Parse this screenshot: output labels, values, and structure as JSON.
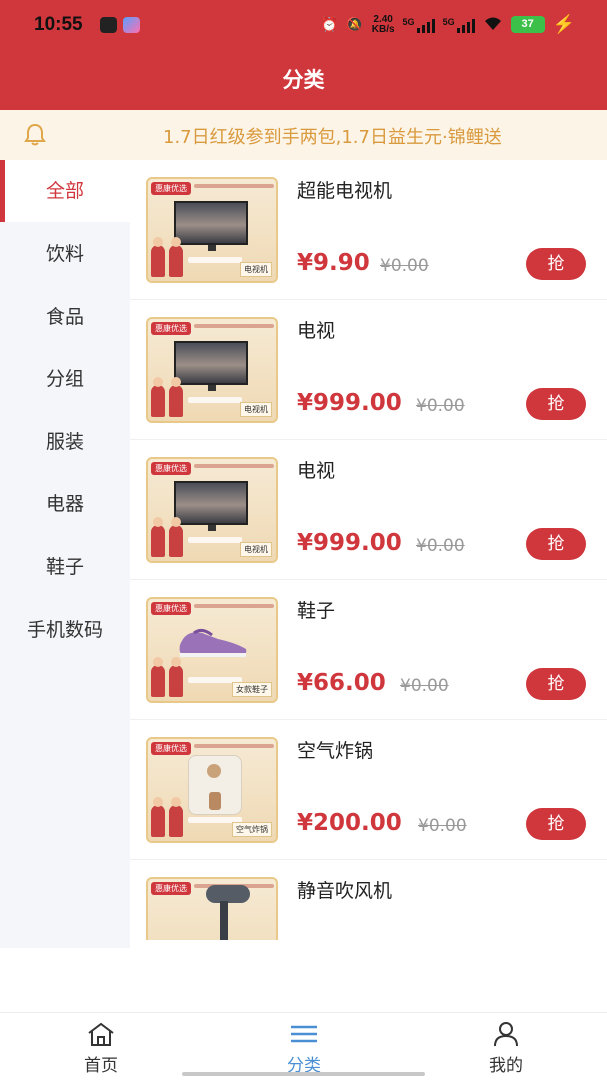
{
  "status_bar": {
    "time": "10:55",
    "speed": "2.40",
    "speed_unit": "KB/s",
    "net1": "5G",
    "net2": "5G",
    "battery": "37"
  },
  "header": {
    "title": "分类"
  },
  "notice": {
    "text": "1.7日红级参到手两包,1.7日益生元·锦鲤送"
  },
  "categories": [
    {
      "label": "全部",
      "active": true
    },
    {
      "label": "饮料"
    },
    {
      "label": "食品"
    },
    {
      "label": "分组"
    },
    {
      "label": "服装"
    },
    {
      "label": "电器"
    },
    {
      "label": "鞋子"
    },
    {
      "label": "手机数码"
    }
  ],
  "products": [
    {
      "name": "超能电视机",
      "price": "¥9.90",
      "original_price": "¥0.00",
      "buy_label": "抢",
      "badge": "惠康优选",
      "thumb_label": "电视机"
    },
    {
      "name": "电视",
      "price": "¥999.00",
      "original_price": "¥0.00",
      "buy_label": "抢",
      "badge": "惠康优选",
      "thumb_label": "电视机"
    },
    {
      "name": "电视",
      "price": "¥999.00",
      "original_price": "¥0.00",
      "buy_label": "抢",
      "badge": "惠康优选",
      "thumb_label": "电视机"
    },
    {
      "name": "鞋子",
      "price": "¥66.00",
      "original_price": "¥0.00",
      "buy_label": "抢",
      "badge": "惠康优选",
      "thumb_label": "女款鞋子"
    },
    {
      "name": "空气炸锅",
      "price": "¥200.00",
      "original_price": "¥0.00",
      "buy_label": "抢",
      "badge": "惠康优选",
      "thumb_label": "空气炸锅"
    },
    {
      "name": "静音吹风机",
      "badge": "惠康优选"
    }
  ],
  "bottom_nav": [
    {
      "label": "首页",
      "icon": "home-icon"
    },
    {
      "label": "分类",
      "icon": "list-icon",
      "active": true
    },
    {
      "label": "我的",
      "icon": "user-icon"
    }
  ],
  "colors": {
    "brand": "#d0373d",
    "notice_text": "#d99a3e",
    "nav_active": "#4a8fd4"
  }
}
